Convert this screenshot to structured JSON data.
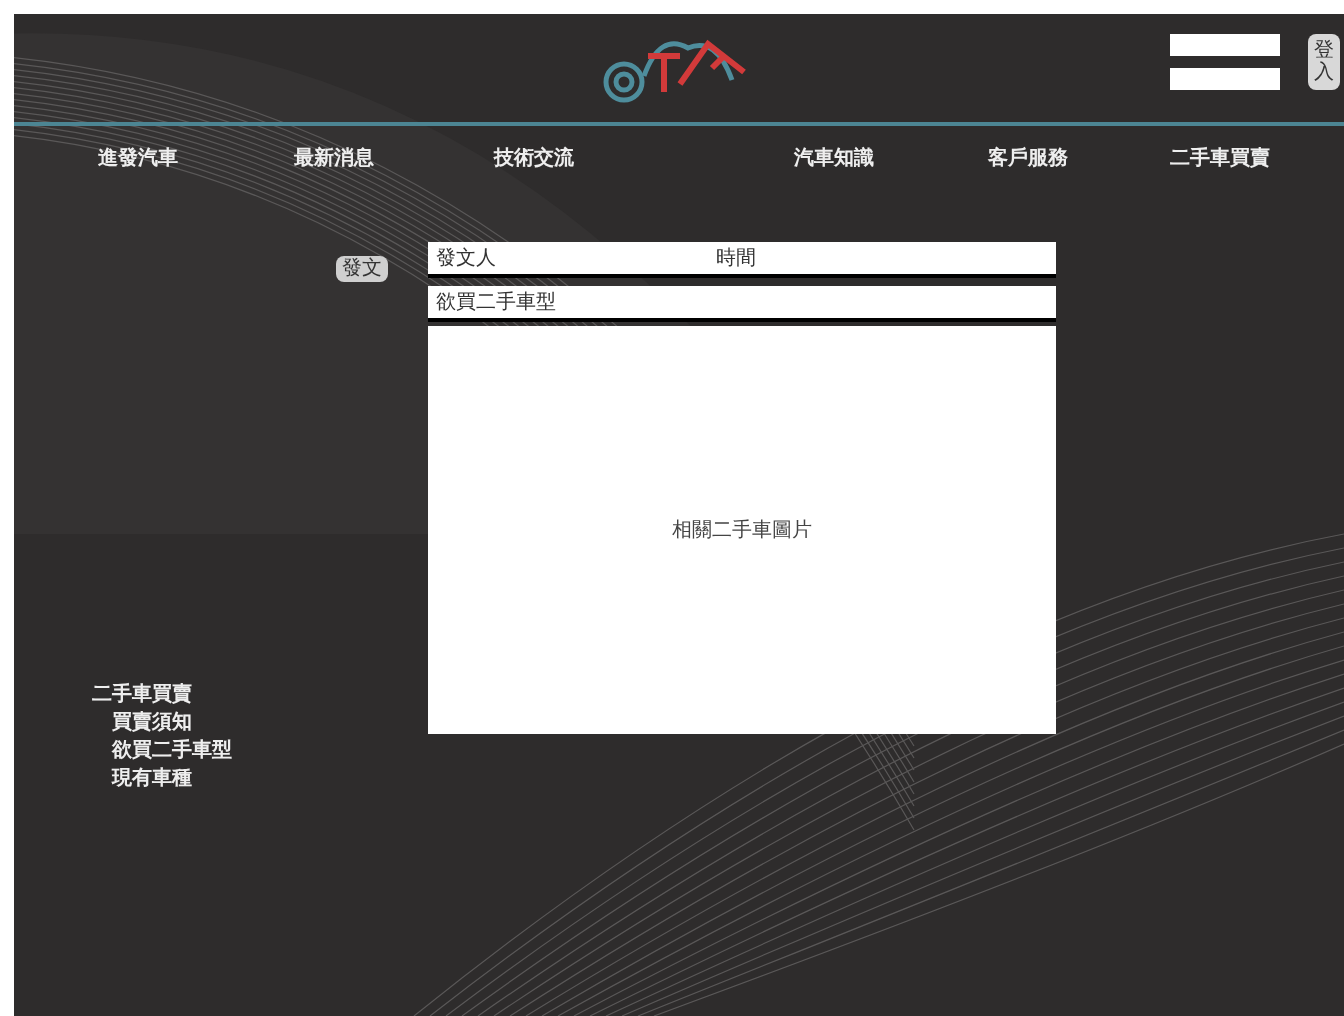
{
  "login": {
    "button": "登入"
  },
  "nav": [
    {
      "label": "進發汽車"
    },
    {
      "label": "最新消息"
    },
    {
      "label": "技術交流"
    },
    {
      "label": "汽車知識"
    },
    {
      "label": "客戶服務"
    },
    {
      "label": "二手車買賣"
    }
  ],
  "post_button": "發文",
  "table": {
    "columns": [
      "發文人",
      "時間"
    ],
    "rows": [
      "欲買二手車型"
    ],
    "image_caption": "相關二手車圖片"
  },
  "sidebar": {
    "items": [
      {
        "label": "二手車買賣",
        "children": [
          {
            "label": "買賣須知"
          },
          {
            "label": "欲買二手車型"
          },
          {
            "label": "現有車種"
          }
        ]
      }
    ]
  }
}
